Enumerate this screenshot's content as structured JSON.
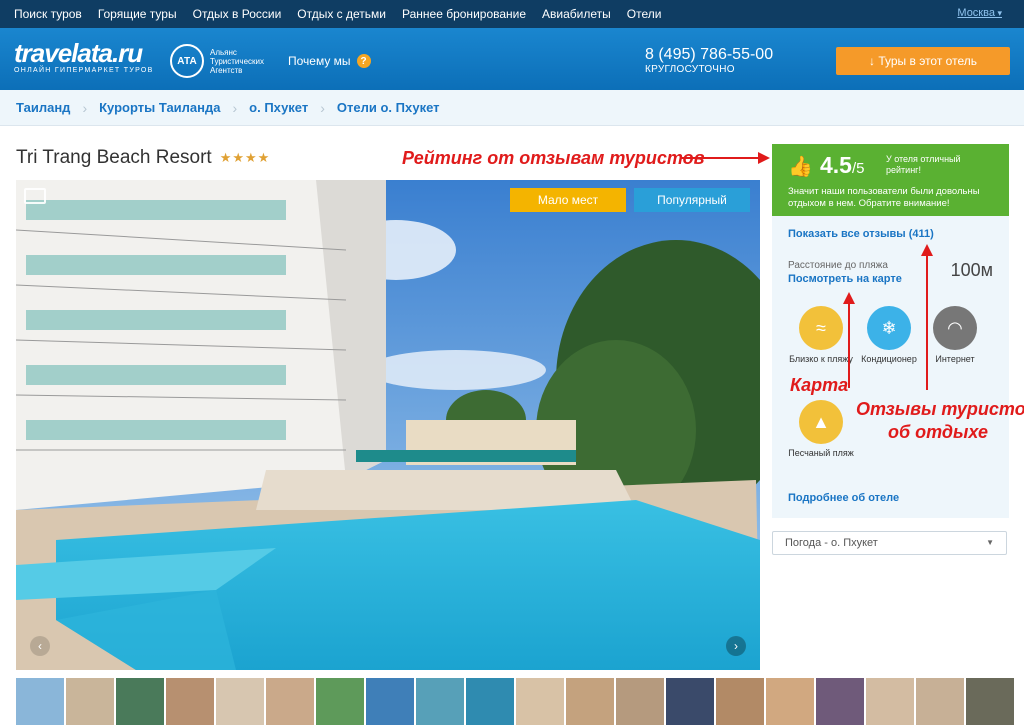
{
  "topnav": {
    "items": [
      "Поиск туров",
      "Горящие туры",
      "Отдых в России",
      "Отдых с детьми",
      "Раннее бронирование",
      "Авиабилеты",
      "Отели"
    ],
    "city": "Москва"
  },
  "header": {
    "logo_name": "travelata.ru",
    "logo_sub": "ОНЛАЙН ГИПЕРМАРКЕТ ТУРОВ",
    "ata_short": "АТА",
    "ata_text": "Альянс Туристических Агентств",
    "why": "Почему мы",
    "phone": "8 (495) 786-55-00",
    "hours": "КРУГЛОСУТОЧНО",
    "tours_button": "↓ Туры в этот отель"
  },
  "breadcrumb": [
    "Таиланд",
    "Курорты Таиланда",
    "о. Пхукет",
    "Отели о. Пхукет"
  ],
  "hotel": {
    "name": "Tri Trang Beach Resort",
    "stars": "★★★★",
    "badge_few": "Мало мест",
    "badge_popular": "Популярный"
  },
  "rating": {
    "score": "4.5",
    "out_of": "/5",
    "verdict": "У отеля отличный рейтинг!",
    "desc": "Значит наши пользователи были довольны отдыхом в нем. Обратите внимание!"
  },
  "panel": {
    "reviews_link": "Показать все отзывы (411)",
    "dist_label": "Расстояние до пляжа",
    "map_link": "Посмотреть на карте",
    "dist_value": "100м",
    "features": [
      {
        "label": "Близко к пляжу",
        "icon": "swimmer-icon",
        "color": "#f2c13a"
      },
      {
        "label": "Кондиционер",
        "icon": "snowflake-icon",
        "color": "#3cb2e8"
      },
      {
        "label": "Интернет",
        "icon": "wifi-icon",
        "color": "#777777"
      },
      {
        "label": "Песчаный пляж",
        "icon": "sand-icon",
        "color": "#f2c13a"
      }
    ],
    "more_link": "Подробнее об отеле"
  },
  "weather_select": "Погода - о. Пхукет",
  "annotations": {
    "rating": "Рейтинг от отзывам туристов",
    "map": "Карта",
    "reviews_line1": "Отзывы туристов",
    "reviews_line2": "об отдыхе"
  },
  "colors": {
    "accent": "#1a75c4",
    "orange": "#f59a29",
    "green": "#5ab132",
    "annotation": "#e01b1b"
  }
}
